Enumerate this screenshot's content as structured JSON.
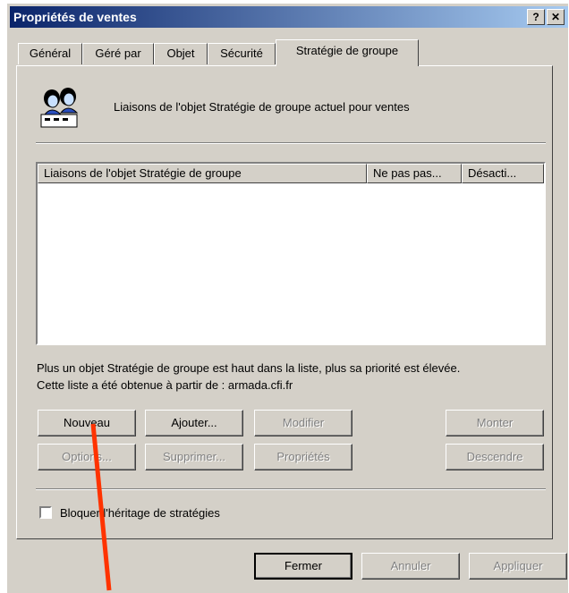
{
  "window": {
    "title": "Propriétés de ventes",
    "help_btn": "?",
    "close_btn": "✕"
  },
  "tabs": [
    "Général",
    "Géré par",
    "Objet",
    "Sécurité",
    "Stratégie de groupe"
  ],
  "header": {
    "description": "Liaisons de l'objet Stratégie de groupe actuel pour ventes",
    "icon": "group-users-icon"
  },
  "list": {
    "columns": [
      "Liaisons de l'objet Stratégie de groupe",
      "Ne pas pas...",
      "Désacti..."
    ],
    "rows": []
  },
  "info": {
    "line1": "Plus un objet Stratégie de groupe est haut dans la liste, plus sa priorité est élevée.",
    "line2": "Cette liste a été obtenue à partir de : armada.cfi.fr"
  },
  "buttons": {
    "nouveau": "Nouveau",
    "ajouter": "Ajouter...",
    "modifier": "Modifier",
    "monter": "Monter",
    "options": "Options...",
    "supprimer": "Supprimer...",
    "proprietes": "Propriétés",
    "descendre": "Descendre"
  },
  "checkbox": {
    "label": "Bloquer l'héritage de stratégies",
    "checked": false
  },
  "footer": {
    "fermer": "Fermer",
    "annuler": "Annuler",
    "appliquer": "Appliquer"
  },
  "annotation": {
    "arrow_color": "#ff3300"
  }
}
